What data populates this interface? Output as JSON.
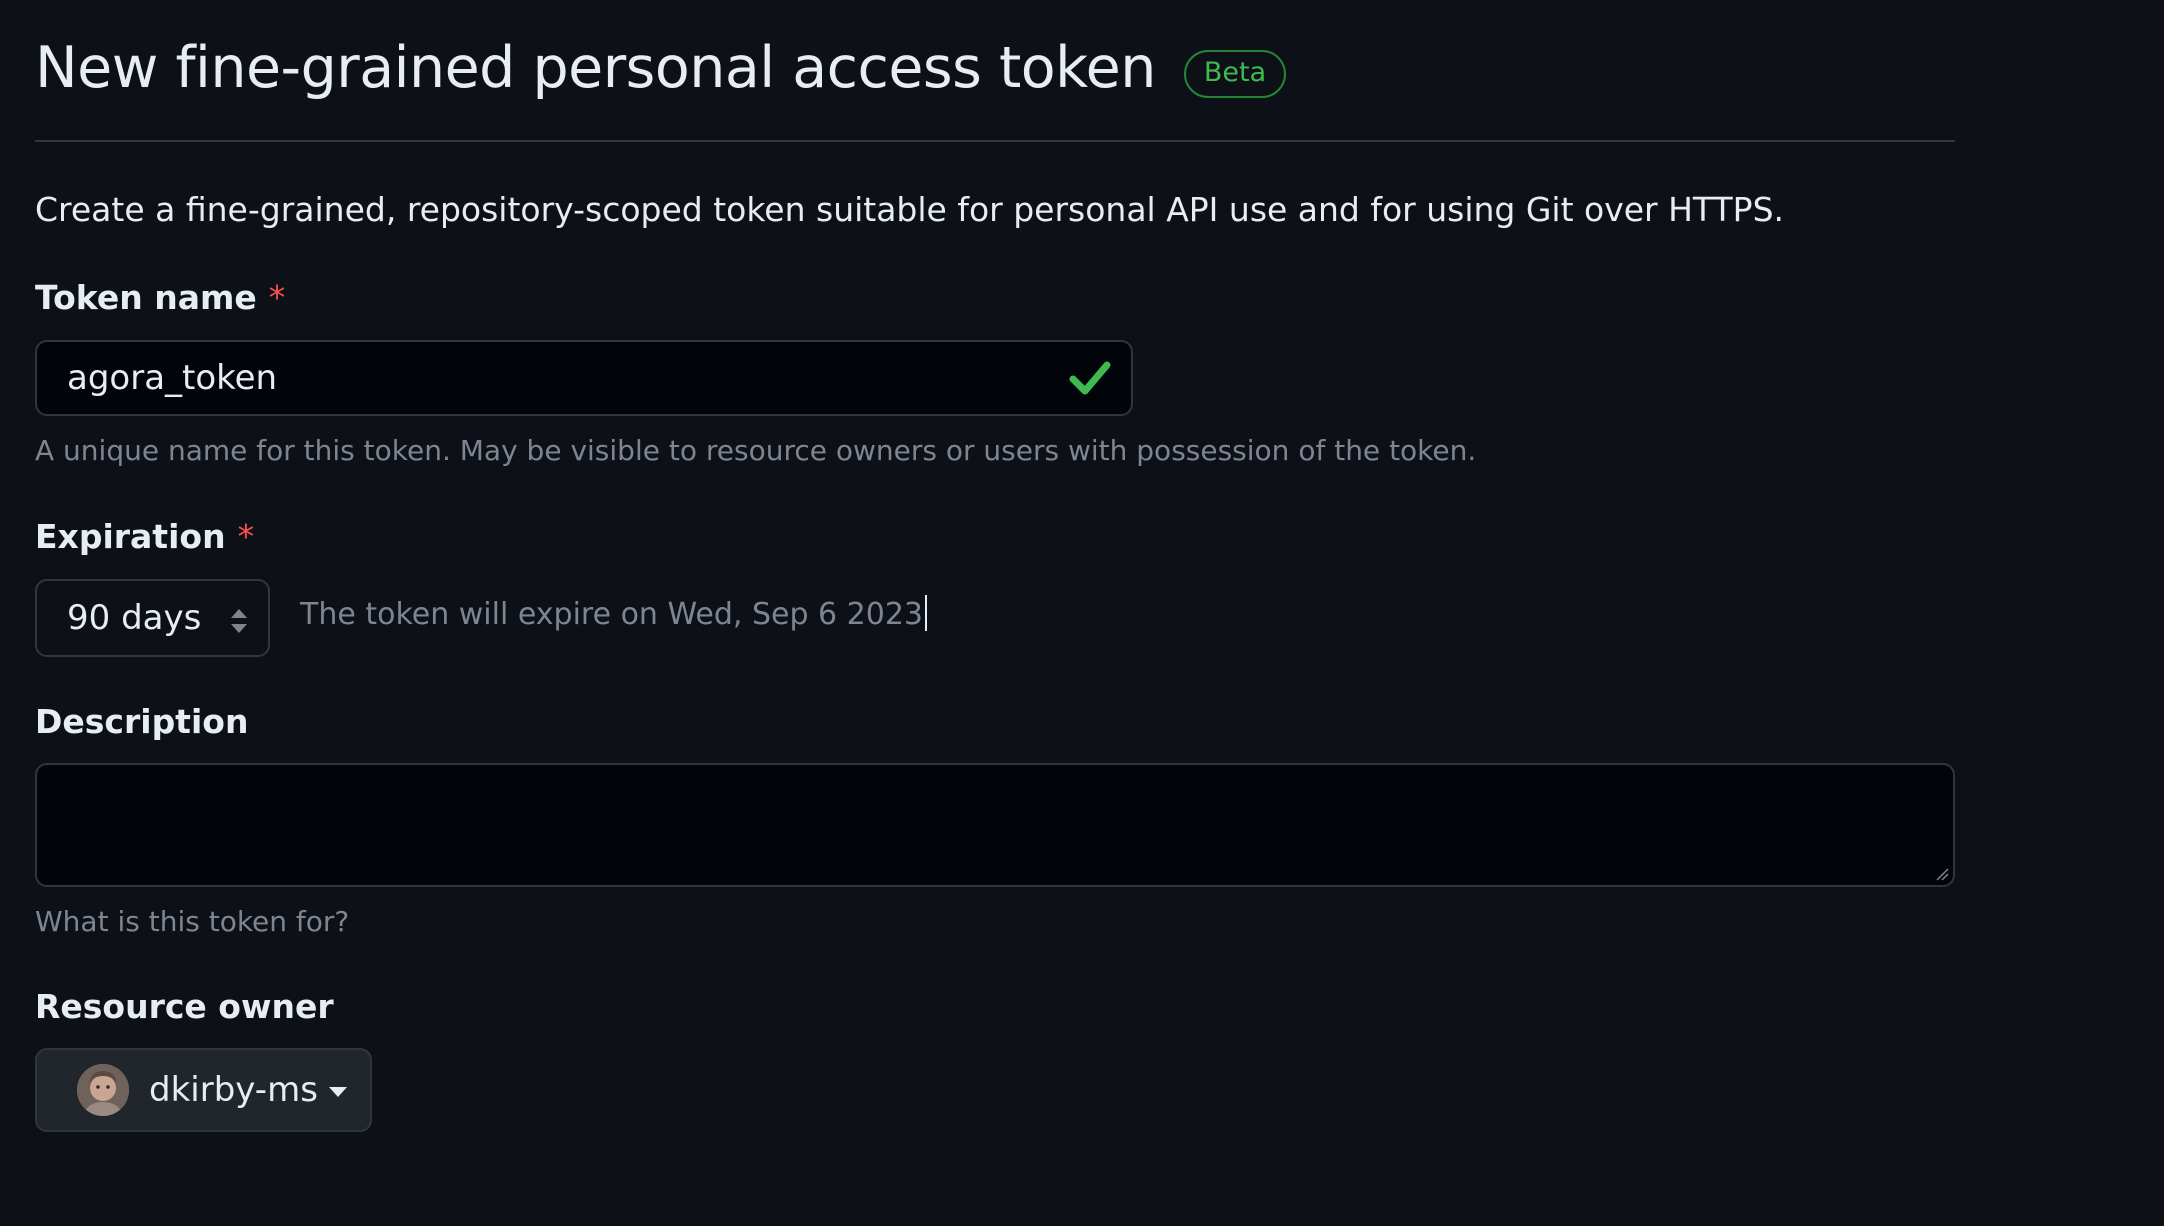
{
  "header": {
    "title": "New fine-grained personal access token",
    "badge": "Beta"
  },
  "intro": "Create a fine-grained, repository-scoped token suitable for personal API use and for using Git over HTTPS.",
  "token_name": {
    "label": "Token name",
    "required_mark": "*",
    "value": "agora_token",
    "valid_icon": "check-icon",
    "hint": "A unique name for this token. May be visible to resource owners or users with possession of the token."
  },
  "expiration": {
    "label": "Expiration",
    "required_mark": "*",
    "selected": "90 days",
    "note": "The token will expire on Wed, Sep 6 2023"
  },
  "description": {
    "label": "Description",
    "value": "",
    "hint": "What is this token for?"
  },
  "resource_owner": {
    "label": "Resource owner",
    "selected": "dkirby-ms"
  },
  "colors": {
    "background": "#0d1117",
    "border": "#30363d",
    "success": "#3fb950",
    "required": "#f85149",
    "muted": "#7d8590"
  }
}
